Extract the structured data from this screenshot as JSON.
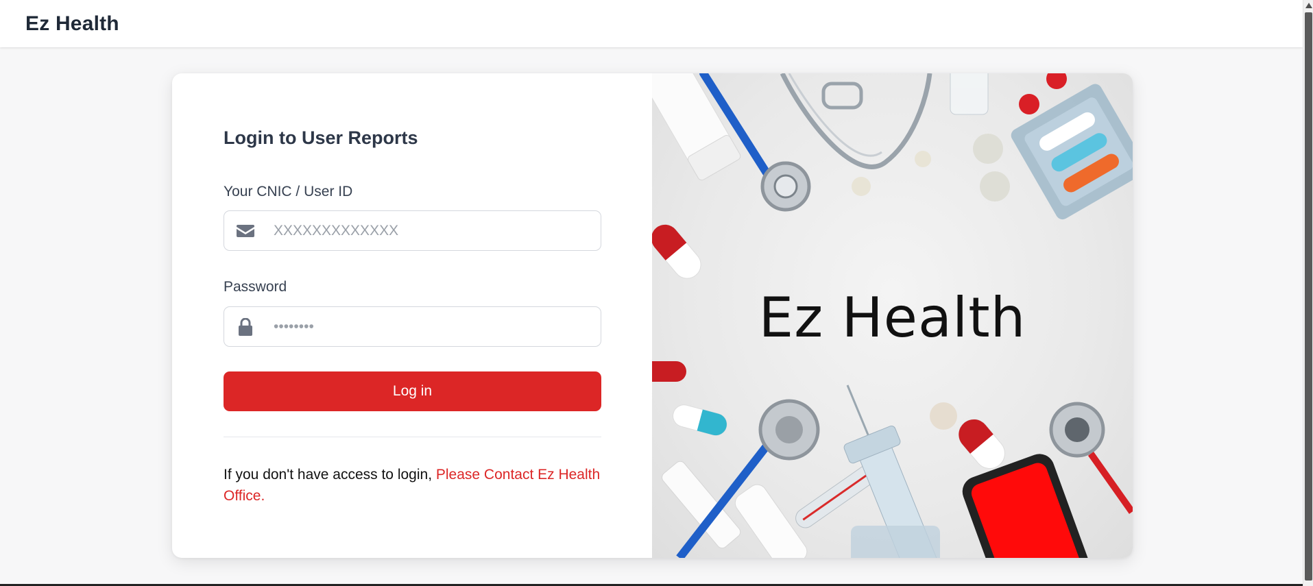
{
  "header": {
    "brand": "Ez Health"
  },
  "login": {
    "title": "Login to User Reports",
    "user_id_label": "Your CNIC / User ID",
    "user_id_placeholder": "XXXXXXXXXXXXX",
    "user_id_value": "",
    "password_label": "Password",
    "password_placeholder": "••••••••",
    "password_value": "",
    "submit_label": "Log in",
    "help_text": "If you don't have access to login, ",
    "help_link": "Please Contact Ez Health Office."
  },
  "hero_image": {
    "wordmark": "Ez Health"
  },
  "colors": {
    "accent": "#dc2626",
    "heading": "#2d3748",
    "input_border": "#d4d7dd"
  },
  "icons": {
    "user_id_field": "envelope-icon",
    "password_field": "lock-icon"
  }
}
